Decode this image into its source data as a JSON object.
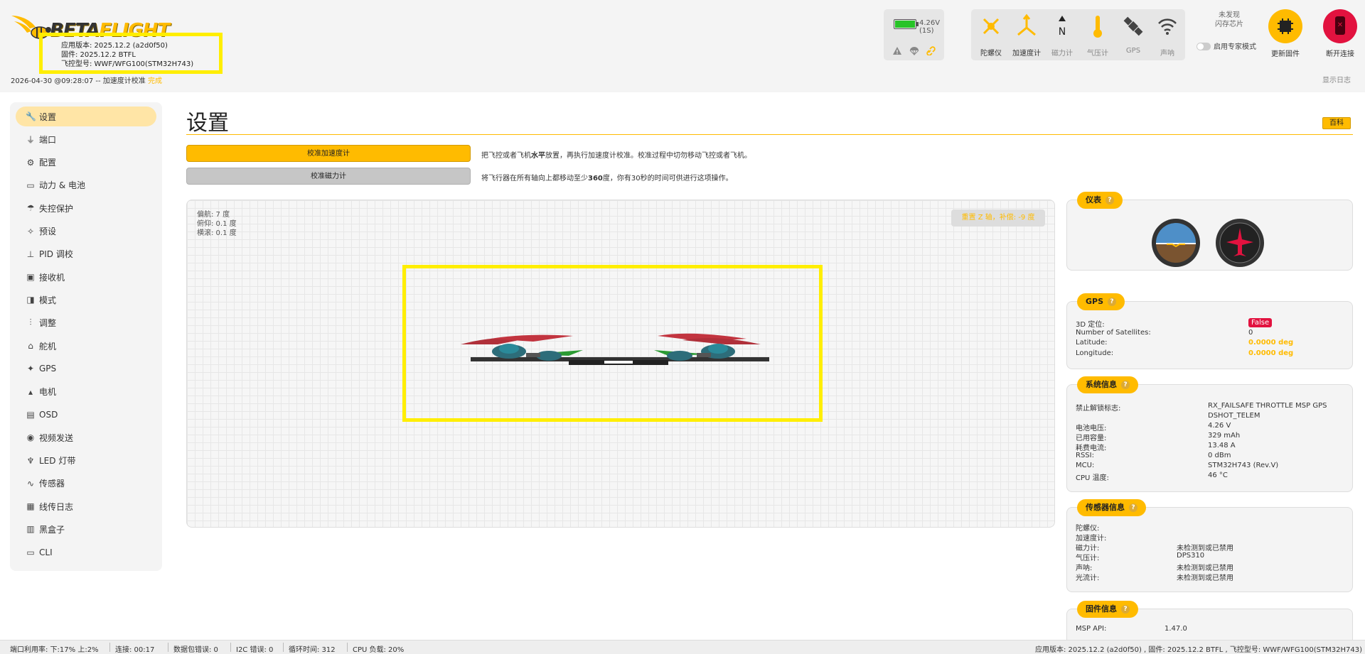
{
  "header": {
    "logo": {
      "word_main": "BETA",
      "word_accent": "FLIGHT"
    },
    "versions": {
      "app": "应用版本: 2025.12.2 (a2d0f50)",
      "firmware": "固件: 2025.12.2 BTFL",
      "board": "飞控型号: WWF/WFG100(STM32H743)"
    },
    "status": {
      "text": "2026-04-30 @09:28:07 -- 加速度计校准",
      "done": "完成"
    },
    "show_log": "显示日志",
    "battery": {
      "value": "4.26V (1S)",
      "level": 1.0
    },
    "sensors": [
      {
        "label": "陀螺仪",
        "icon": "gyro-icon",
        "active": true
      },
      {
        "label": "加速度计",
        "icon": "accel-icon",
        "active": true
      },
      {
        "label": "磁力计",
        "icon": "mag-icon",
        "active": false
      },
      {
        "label": "气压计",
        "icon": "baro-icon",
        "active": true
      },
      {
        "label": "GPS",
        "icon": "gps-icon",
        "active": false
      },
      {
        "label": "声呐",
        "icon": "sonar-icon",
        "active": false
      }
    ],
    "flash_chip": "未发现\n闪存芯片",
    "flash_line1": "未发现",
    "flash_line2": "闪存芯片",
    "expert_mode": "启用专家模式",
    "update_firmware": "更新固件",
    "disconnect": "断开连接",
    "mag_letter": "N",
    "colors": {
      "accent": "#ffbb00",
      "danger": "#e2123f",
      "highlight": "#ffee00"
    }
  },
  "sidebar": {
    "items": [
      {
        "label": "设置",
        "icon": "wrench-icon",
        "active": true
      },
      {
        "label": "端口",
        "icon": "plug-icon",
        "active": false
      },
      {
        "label": "配置",
        "icon": "gear-icon",
        "active": false
      },
      {
        "label": "动力 & 电池",
        "icon": "battery-icon",
        "active": false
      },
      {
        "label": "失控保护",
        "icon": "parachute-icon",
        "active": false
      },
      {
        "label": "预设",
        "icon": "magic-wand-icon",
        "active": false
      },
      {
        "label": "PID 调校",
        "icon": "pid-icon",
        "active": false
      },
      {
        "label": "接收机",
        "icon": "receiver-icon",
        "active": false
      },
      {
        "label": "模式",
        "icon": "toggle-icon",
        "active": false
      },
      {
        "label": "调整",
        "icon": "sliders-icon",
        "active": false
      },
      {
        "label": "舵机",
        "icon": "servo-icon",
        "active": false
      },
      {
        "label": "GPS",
        "icon": "satellite-icon",
        "active": false
      },
      {
        "label": "电机",
        "icon": "motor-icon",
        "active": false
      },
      {
        "label": "OSD",
        "icon": "osd-icon",
        "active": false
      },
      {
        "label": "视频发送",
        "icon": "broadcast-icon",
        "active": false
      },
      {
        "label": "LED 灯带",
        "icon": "led-icon",
        "active": false
      },
      {
        "label": "传感器",
        "icon": "pulse-icon",
        "active": false
      },
      {
        "label": "线传日志",
        "icon": "tether-icon",
        "active": false
      },
      {
        "label": "黑盒子",
        "icon": "blackbox-icon",
        "active": false
      },
      {
        "label": "CLI",
        "icon": "terminal-icon",
        "active": false
      }
    ]
  },
  "main": {
    "title": "设置",
    "wiki": "百科",
    "calibrate_acc": {
      "label": "校准加速度计",
      "desc_pre": "把飞控或者飞机",
      "desc_bold": "水平",
      "desc_post": "放置，再执行加速度计校准。校准过程中切勿移动飞控或者飞机。"
    },
    "calibrate_mag": {
      "label": "校准磁力计",
      "desc_pre": "将飞行器在所有轴向上都移动至少",
      "desc_bold": "360",
      "desc_post": "度，你有30秒的时间可供进行这项操作。"
    },
    "attitude": {
      "yaw": "偏航:  7 度",
      "pitch": "俯仰:  0.1 度",
      "roll": "横滚:  0.1 度"
    },
    "reset_z": "重置 Z 轴，补偿: -9 度"
  },
  "panels": {
    "instruments": {
      "title": "仪表"
    },
    "gps": {
      "title": "GPS",
      "rows": [
        {
          "k": "3D 定位:",
          "v": "False",
          "style": "badge"
        },
        {
          "k": "Number of Satellites:",
          "v": "0",
          "style": "plain"
        },
        {
          "k": "Latitude:",
          "v": "0.0000 deg",
          "style": "orange"
        },
        {
          "k": "Longitude:",
          "v": "0.0000 deg",
          "style": "orange"
        }
      ]
    },
    "system": {
      "title": "系统信息",
      "arming_key": "禁止解锁标志:",
      "arming_v1": "RX_FAILSAFE THROTTLE MSP GPS",
      "arming_v2": "DSHOT_TELEM",
      "rows": [
        {
          "k": "电池电压:",
          "v": "4.26 V"
        },
        {
          "k": "已用容量:",
          "v": "329 mAh"
        },
        {
          "k": "耗费电流:",
          "v": "13.48 A"
        },
        {
          "k": "RSSI:",
          "v": "0 dBm"
        },
        {
          "k": "MCU:",
          "v": "STM32H743 (Rev.V)"
        },
        {
          "k": "CPU 温度:",
          "v": "46 °C"
        }
      ]
    },
    "sensor_info": {
      "title": "传感器信息",
      "rows": [
        {
          "k": "陀螺仪:",
          "v": ""
        },
        {
          "k": "加速度计:",
          "v": ""
        },
        {
          "k": "磁力计:",
          "v": "未检测到或已禁用"
        },
        {
          "k": "气压计:",
          "v": "DPS310"
        },
        {
          "k": "声呐:",
          "v": "未检测到或已禁用"
        },
        {
          "k": "光流计:",
          "v": "未检测到或已禁用"
        }
      ]
    },
    "firmware": {
      "title": "固件信息",
      "rows": [
        {
          "k": "MSP API:",
          "v": "1.47.0"
        }
      ]
    }
  },
  "footer": {
    "port_util": "端口利用率:  下:17% 上:2%",
    "connection": "连接:   00:17",
    "packet_err": "数据包错误:  0",
    "i2c_err": "I2C 错误:  0",
    "cycle": "循环时间:  312",
    "cpu": "CPU 负载:  20%",
    "right": "应用版本: 2025.12.2 (a2d0f50) , 固件: 2025.12.2 BTFL , 飞控型号: WWF/WFG100(STM32H743)"
  }
}
